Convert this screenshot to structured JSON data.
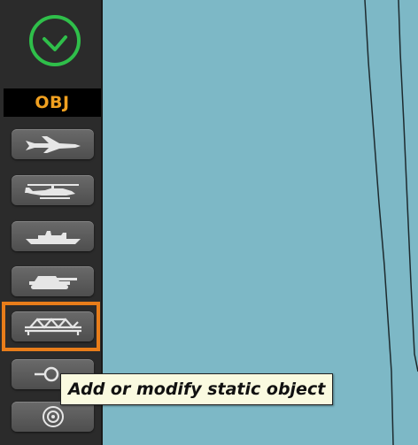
{
  "sidebar": {
    "confirm_icon": "checkmark-circle-icon",
    "header_label": "OBJ",
    "accent_color": "#e87d1a",
    "header_color": "#f0a020",
    "confirm_color": "#2fbf4a",
    "tools": [
      {
        "name": "airplane",
        "icon": "fighter-jet-icon"
      },
      {
        "name": "helicopter",
        "icon": "helicopter-icon"
      },
      {
        "name": "ship",
        "icon": "ship-icon"
      },
      {
        "name": "ground-unit",
        "icon": "tank-icon"
      },
      {
        "name": "static-object",
        "icon": "bridge-icon",
        "selected": true
      },
      {
        "name": "trigger-zone",
        "icon": "zone-icon"
      },
      {
        "name": "target",
        "icon": "target-icon"
      }
    ]
  },
  "tooltip": {
    "text": "Add or modify static object"
  },
  "map": {
    "background_color": "#7db8c6"
  }
}
